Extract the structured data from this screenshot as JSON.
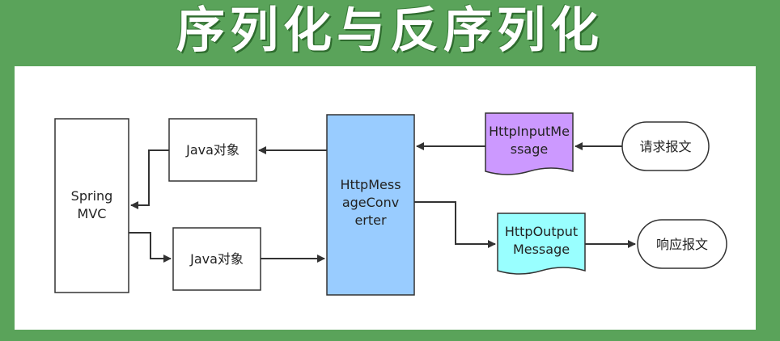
{
  "title": "序列化与反序列化",
  "colors": {
    "background": "#5aa35a",
    "converter_fill": "#99ccff",
    "input_message_fill": "#cc99ff",
    "output_message_fill": "#99ffff"
  },
  "diagram": {
    "spring_mvc": {
      "line1": "Spring",
      "line2": "MVC"
    },
    "java_object_top": "Java对象",
    "java_object_bottom": "Java对象",
    "converter": {
      "line1": "HttpMess",
      "line2": "ageConv",
      "line3": "erter"
    },
    "input_message": {
      "line1": "HttpInputMe",
      "line2": "ssage"
    },
    "output_message": {
      "line1": "HttpOutput",
      "line2": "Message"
    },
    "request_message": "请求报文",
    "response_message": "响应报文"
  }
}
